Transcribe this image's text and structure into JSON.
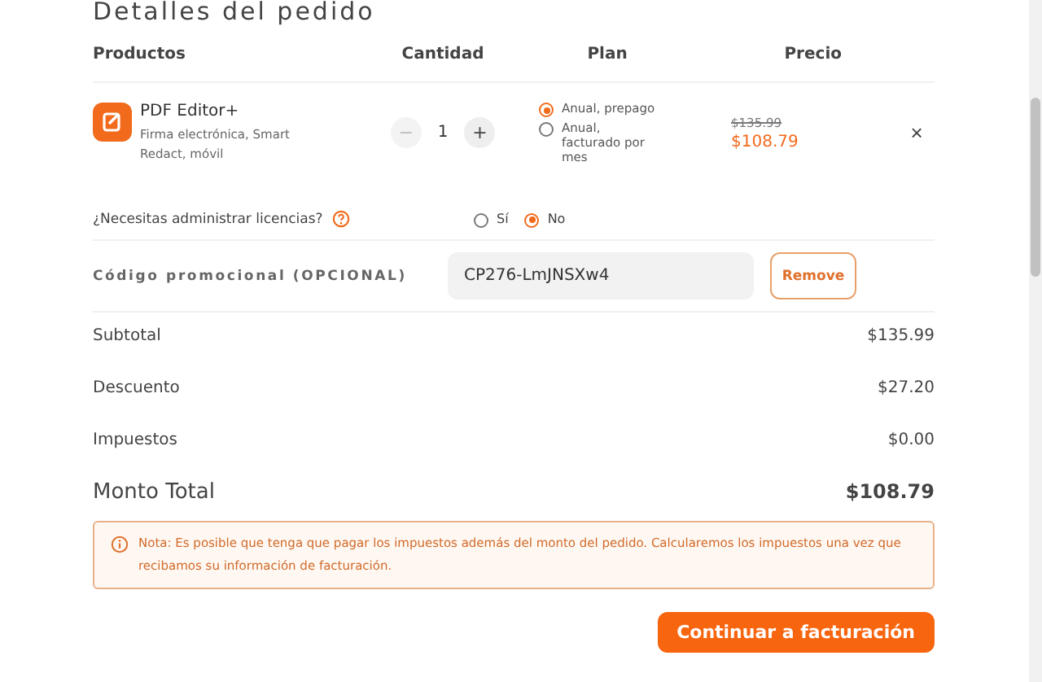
{
  "title": "Detalles del pedido",
  "columns": [
    "Productos",
    "Cantidad",
    "Plan",
    "Precio"
  ],
  "product": {
    "name": "PDF Editor+",
    "description": "Firma electrónica, Smart Redact, móvil",
    "quantity": "1",
    "decrement": "−",
    "increment": "+",
    "remove": "×",
    "plans": [
      {
        "label": "Anual, prepago",
        "selected": true
      },
      {
        "label": "Anual, facturado por mes",
        "selected": false
      }
    ],
    "original_price": "$135.99",
    "price": "$108.79"
  },
  "licenses": {
    "question": "¿Necesitas administrar licencias?",
    "options": [
      {
        "label": "Sí",
        "selected": false
      },
      {
        "label": "No",
        "selected": true
      }
    ]
  },
  "promo": {
    "label": "Código promocional (OPCIONAL)",
    "value": "CP276-LmJNSXw4",
    "button": "Remove"
  },
  "summary": [
    {
      "label": "Subtotal",
      "value": "$135.99"
    },
    {
      "label": "Descuento",
      "value": "$27.20"
    },
    {
      "label": "Impuestos",
      "value": "$0.00"
    }
  ],
  "total": {
    "label": "Monto Total",
    "value": "$108.79"
  },
  "note": "Nota: Es posible que tenga que pagar los impuestos además del monto del pedido. Calcularemos los impuestos una vez que recibamos su información de facturación.",
  "continue_button": "Continuar a facturación"
}
